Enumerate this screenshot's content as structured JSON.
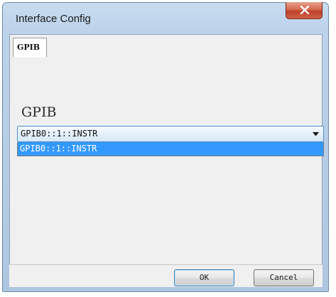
{
  "window": {
    "title": "Interface Config"
  },
  "tabs": [
    {
      "label": "GPIB",
      "selected": true
    }
  ],
  "gpib": {
    "group_label": "GPIB",
    "combo_value": "GPIB0::1::INSTR",
    "dropdown_options": [
      "GPIB0::1::INSTR"
    ]
  },
  "buttons": {
    "ok_label": "OK",
    "cancel_label": "Cancel"
  },
  "colors": {
    "selection": "#3399ff",
    "close_button": "#c9462e",
    "combo_border": "#4f8fcc"
  },
  "icons": {
    "close": "close-icon",
    "dropdown": "chevron-down-icon"
  }
}
